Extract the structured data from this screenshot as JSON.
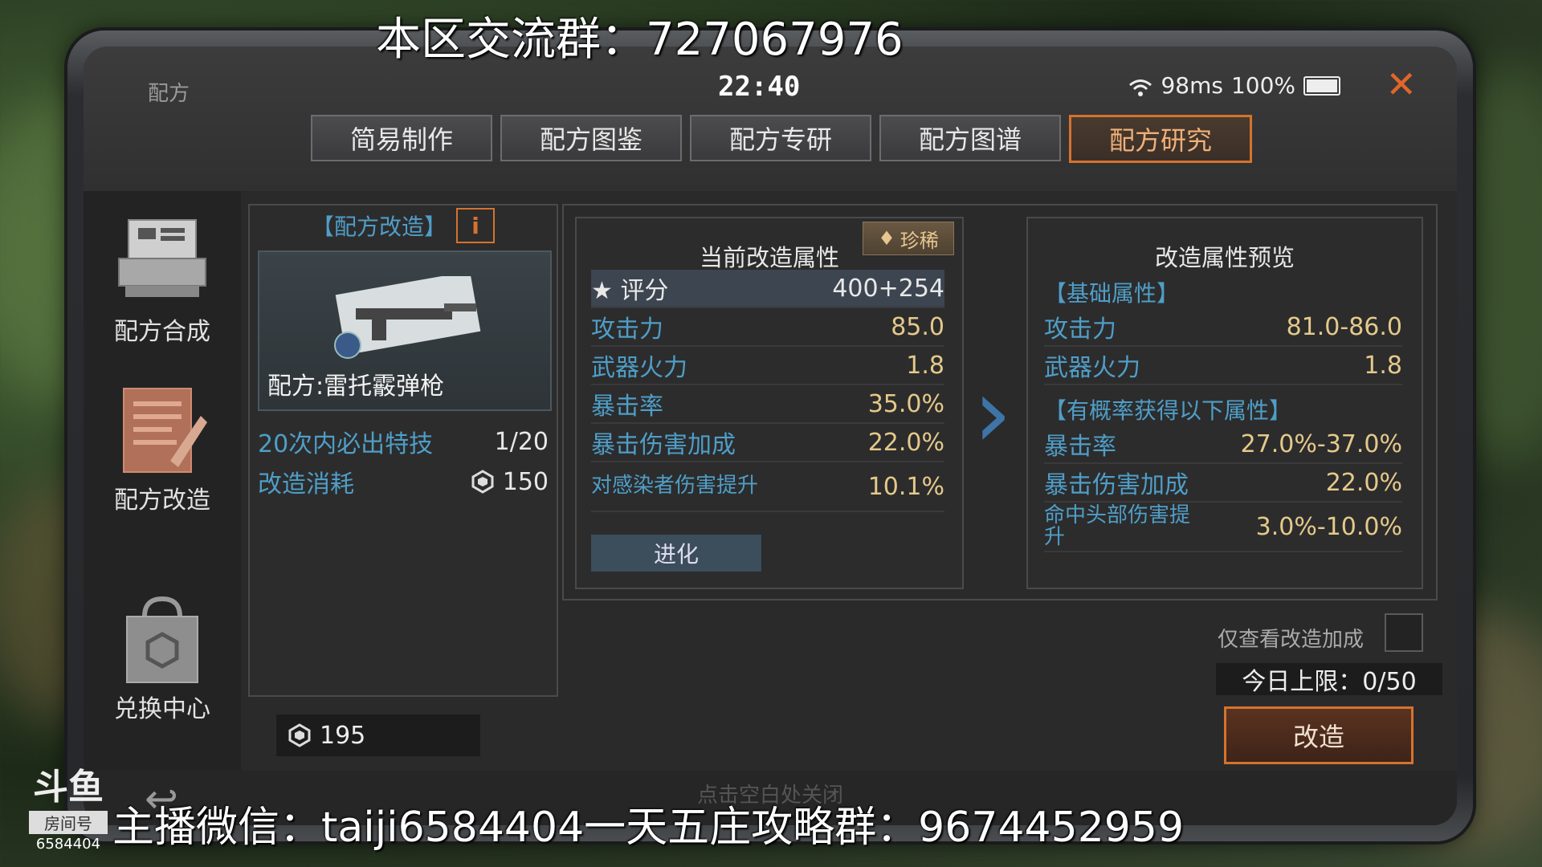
{
  "overlay": {
    "top_text": "本区交流群：727067976",
    "bottom_text": "主播微信：taiji6584404一天五庄攻略群：9674452959"
  },
  "douyu": {
    "logo": "斗鱼",
    "room_label": "房间号",
    "room_number": "6584404"
  },
  "header": {
    "title": "配方",
    "time": "22:40",
    "ping": "98ms",
    "battery": "100%",
    "battery_level": 1.0
  },
  "tabs": [
    {
      "label": "简易制作",
      "active": false
    },
    {
      "label": "配方图鉴",
      "active": false
    },
    {
      "label": "配方专研",
      "active": false
    },
    {
      "label": "配方图谱",
      "active": false
    },
    {
      "label": "配方研究",
      "active": true
    }
  ],
  "sidebar": {
    "items": [
      {
        "label": "配方合成",
        "icon": "printer-icon"
      },
      {
        "label": "配方改造",
        "icon": "document-pen-icon"
      },
      {
        "label": "兑换中心",
        "icon": "shopping-bag-icon"
      }
    ]
  },
  "recipe_panel": {
    "title": "【配方改造】",
    "info": "i",
    "recipe_name": "配方:雷托霰弹枪",
    "guarantee_label": "20次内必出特技",
    "guarantee_value": "1/20",
    "cost_label": "改造消耗",
    "cost_value": "150",
    "currency_balance": "195"
  },
  "current_attributes": {
    "title": "当前改造属性",
    "rarity": "珍稀",
    "score_label": "评分",
    "score_value": "400+254",
    "stats": [
      {
        "label": "攻击力",
        "value": "85.0"
      },
      {
        "label": "武器火力",
        "value": "1.8"
      },
      {
        "label": "暴击率",
        "value": "35.0%"
      },
      {
        "label": "暴击伤害加成",
        "value": "22.0%"
      },
      {
        "label": "对感染者伤害提升",
        "value": "10.1%"
      }
    ],
    "evolve_label": "进化"
  },
  "preview_attributes": {
    "title": "改造属性预览",
    "base_section": "【基础属性】",
    "base_stats": [
      {
        "label": "攻击力",
        "value": "81.0-86.0"
      },
      {
        "label": "武器火力",
        "value": "1.8"
      }
    ],
    "chance_section": "【有概率获得以下属性】",
    "chance_stats": [
      {
        "label": "暴击率",
        "value": "27.0%-37.0%"
      },
      {
        "label": "暴击伤害加成",
        "value": "22.0%"
      },
      {
        "label": "命中头部伤害提升",
        "value": "3.0%-10.0%"
      }
    ]
  },
  "controls": {
    "only_view_label": "仅查看改造加成",
    "daily_limit": "今日上限：0/50",
    "modify_label": "改造",
    "close_hint": "点击空白处关闭"
  }
}
